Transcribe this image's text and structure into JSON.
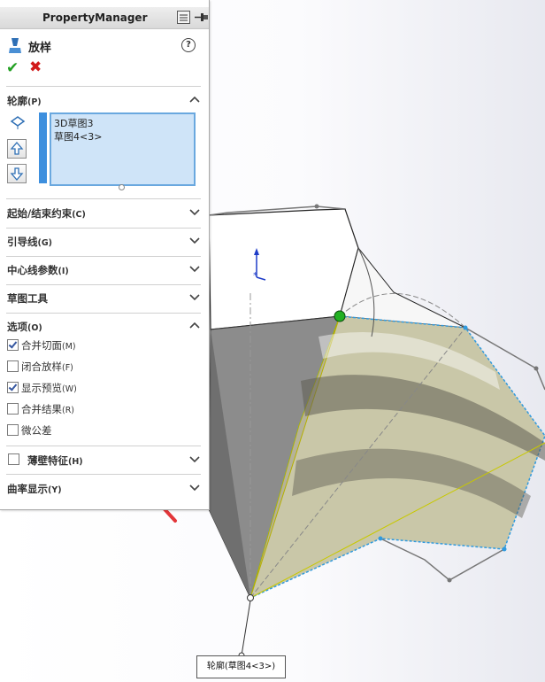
{
  "panel": {
    "title": "PropertyManager",
    "feature_name": "放样",
    "help_symbol": "?"
  },
  "profile": {
    "label": "轮廓",
    "key": "(P)",
    "items": [
      "3D草图3",
      "草图4<3>"
    ]
  },
  "sections": [
    {
      "label": "起始/结束约束",
      "key": "(C)"
    },
    {
      "label": "引导线",
      "key": "(G)"
    },
    {
      "label": "中心线参数",
      "key": "(I)"
    },
    {
      "label": "草图工具",
      "key": ""
    }
  ],
  "options": {
    "label": "选项",
    "key": "(O)",
    "items": [
      {
        "label": "合并切面",
        "key": "(M)",
        "checked": true
      },
      {
        "label": "闭合放样",
        "key": "(F)",
        "checked": false
      },
      {
        "label": "显示预览",
        "key": "(W)",
        "checked": true
      },
      {
        "label": "合并结果",
        "key": "(R)",
        "checked": false
      },
      {
        "label": "微公差",
        "key": "",
        "checked": false
      }
    ]
  },
  "thin_feature": {
    "label": "薄壁特征",
    "key": "(H)",
    "checked": false
  },
  "curvature": {
    "label": "曲率显示",
    "key": "(Y)"
  },
  "callout": {
    "text": "轮廓(草图4<3>)"
  },
  "colors": {
    "accent": "#3d8fde",
    "list_bg": "#cfe4f8",
    "ok": "#22a022",
    "cancel": "#d11a1a",
    "arrow": "#e3363a"
  }
}
